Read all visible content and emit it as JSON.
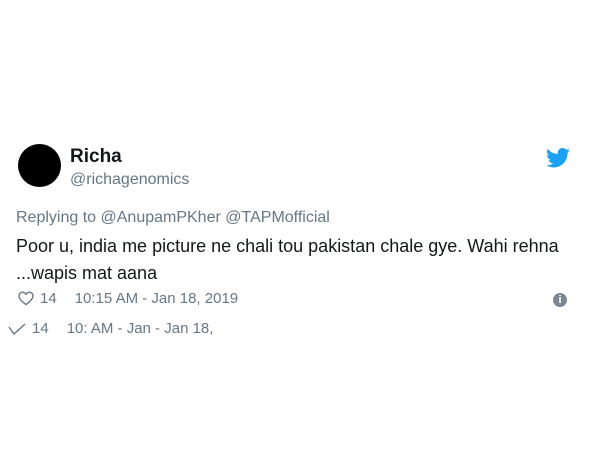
{
  "user": {
    "name": "Richa",
    "handle": "@richagenomics"
  },
  "reply": {
    "prefix": "Replying to",
    "mention_1": "@AnupamPKher",
    "mention_2": "@TAPMofficial"
  },
  "tweet": {
    "text": "Poor u, india me picture ne chali tou pakistan chale gye. Wahi rehna ...wapis mat aana",
    "likes": "14",
    "timestamp": "10:15 AM - Jan 18, 2019"
  },
  "ghost": {
    "likes": "14",
    "timestamp": "10: AM - Jan - Jan 18,"
  },
  "icons": {
    "brand": "twitter-bird-icon",
    "like": "heart-icon",
    "info": "info-icon"
  },
  "colors": {
    "brand": "#1da1f2",
    "secondary_text": "#657786",
    "primary_text": "#14171a"
  }
}
